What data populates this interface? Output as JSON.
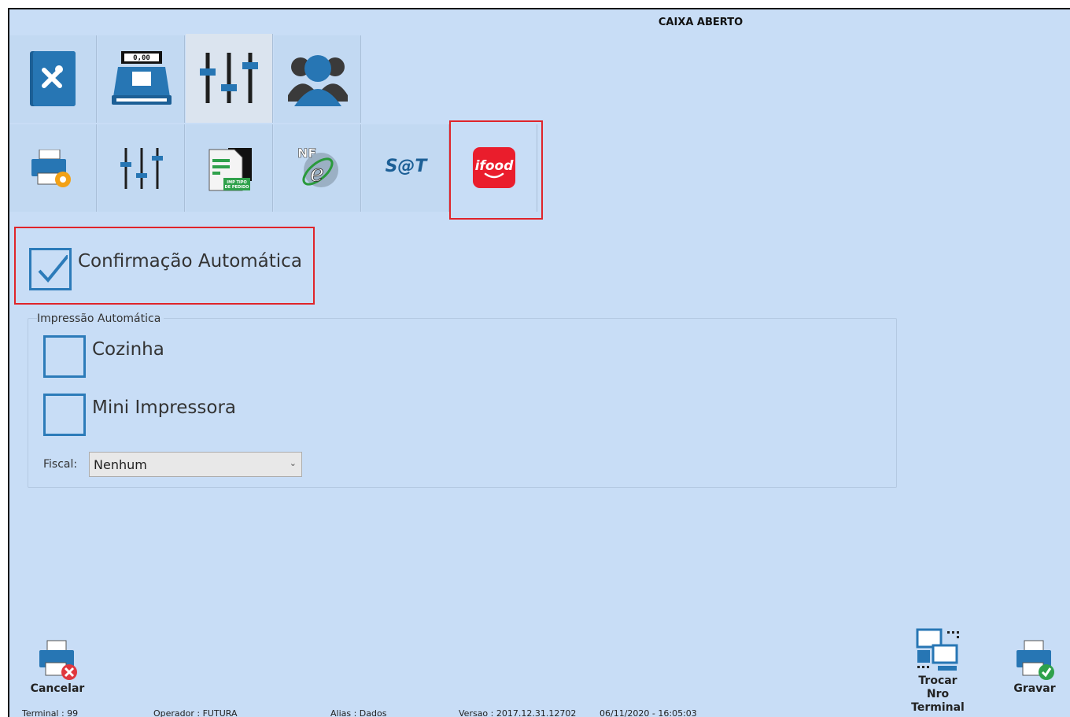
{
  "header": {
    "title": "CAIXA ABERTO"
  },
  "top_tabs": [
    {
      "icon": "menu-book-utensils-icon"
    },
    {
      "icon": "cash-register-icon",
      "display": "0,00"
    },
    {
      "icon": "sliders-icon"
    },
    {
      "icon": "users-icon"
    }
  ],
  "sub_tabs": [
    {
      "icon": "printer-settings-icon"
    },
    {
      "icon": "sliders-icon"
    },
    {
      "icon": "document-order-type-icon",
      "caption": "IMP TIPO DE PEDIDO"
    },
    {
      "icon": "nfe-icon",
      "caption": "NF e"
    },
    {
      "icon": "sat-icon",
      "caption": "S@T"
    },
    {
      "icon": "ifood-icon",
      "caption": "ifood"
    }
  ],
  "accent": {
    "highlight": "#e0242a",
    "checkbox": "#2c7bb9",
    "background": "#c8ddf6",
    "ifood_red": "#ea1d2c"
  },
  "settings": {
    "auto_confirm": {
      "label": "Confirmação Automática",
      "checked": true
    },
    "auto_print": {
      "group_title": "Impressão Automática",
      "kitchen": {
        "label": "Cozinha",
        "checked": false
      },
      "mini_printer": {
        "label": "Mini Impressora",
        "checked": false
      }
    },
    "fiscal": {
      "label": "Fiscal:",
      "value": "Nenhum"
    }
  },
  "actions": {
    "cancel": "Cancelar",
    "switch_terminal_line1": "Trocar",
    "switch_terminal_line2": "Nro Terminal",
    "save": "Gravar"
  },
  "status_bar": {
    "terminal": "Terminal : 99",
    "operator": "Operador : FUTURA",
    "alias": "Alias : Dados",
    "version": "Versao : 2017.12.31.12702",
    "datetime": "06/11/2020 - 16:05:03"
  }
}
